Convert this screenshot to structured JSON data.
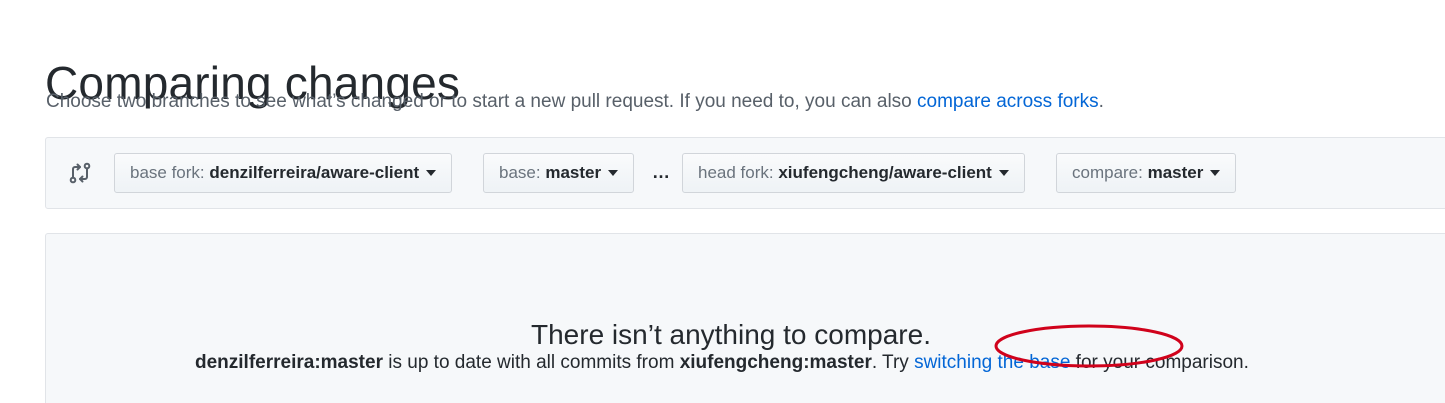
{
  "header": {
    "title": "Comparing changes",
    "subtitle_text": "Choose two branches to see what’s changed or to start a new pull request. If you need to, you can also ",
    "subtitle_link": "compare across forks",
    "subtitle_end": "."
  },
  "range_editor": {
    "icon": "git-compare-icon",
    "base_fork": {
      "label": "base fork:",
      "value": "denzilferreira/aware-client"
    },
    "base": {
      "label": "base:",
      "value": "master"
    },
    "separator": "…",
    "head_fork": {
      "label": "head fork:",
      "value": "xiufengcheng/aware-client"
    },
    "compare": {
      "label": "compare:",
      "value": "master"
    }
  },
  "blankslate": {
    "title": "There isn’t anything to compare.",
    "base_ref": "denzilferreira:master",
    "middle_text": " is up to date with all commits from ",
    "head_ref": "xiufengcheng:master",
    "try_text": ". Try ",
    "link": "switching the base",
    "end_text": " for your comparison."
  },
  "colors": {
    "link": "#0366d6",
    "annotation": "#d0021b"
  }
}
